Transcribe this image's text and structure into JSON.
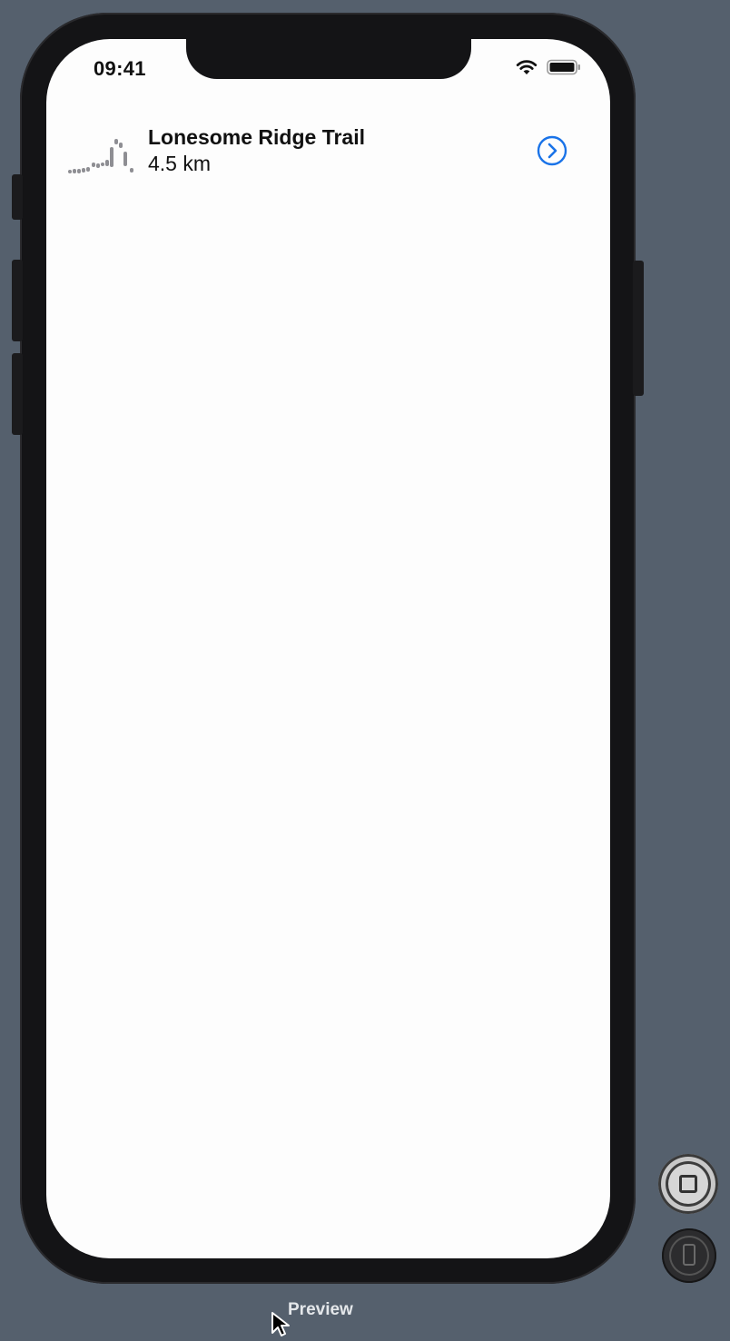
{
  "status_bar": {
    "time": "09:41",
    "wifi_icon": "wifi-icon",
    "battery_icon": "battery-icon"
  },
  "trail": {
    "name": "Lonesome Ridge Trail",
    "distance": "4.5 km",
    "graph_icon": "elevation-graph-icon",
    "detail_icon": "chevron-right-circle-icon",
    "accent_color": "#1a73e8"
  },
  "preview_controls": {
    "live_icon": "live-preview-icon",
    "device_icon": "device-icon"
  },
  "bottom": {
    "label": "Preview"
  }
}
